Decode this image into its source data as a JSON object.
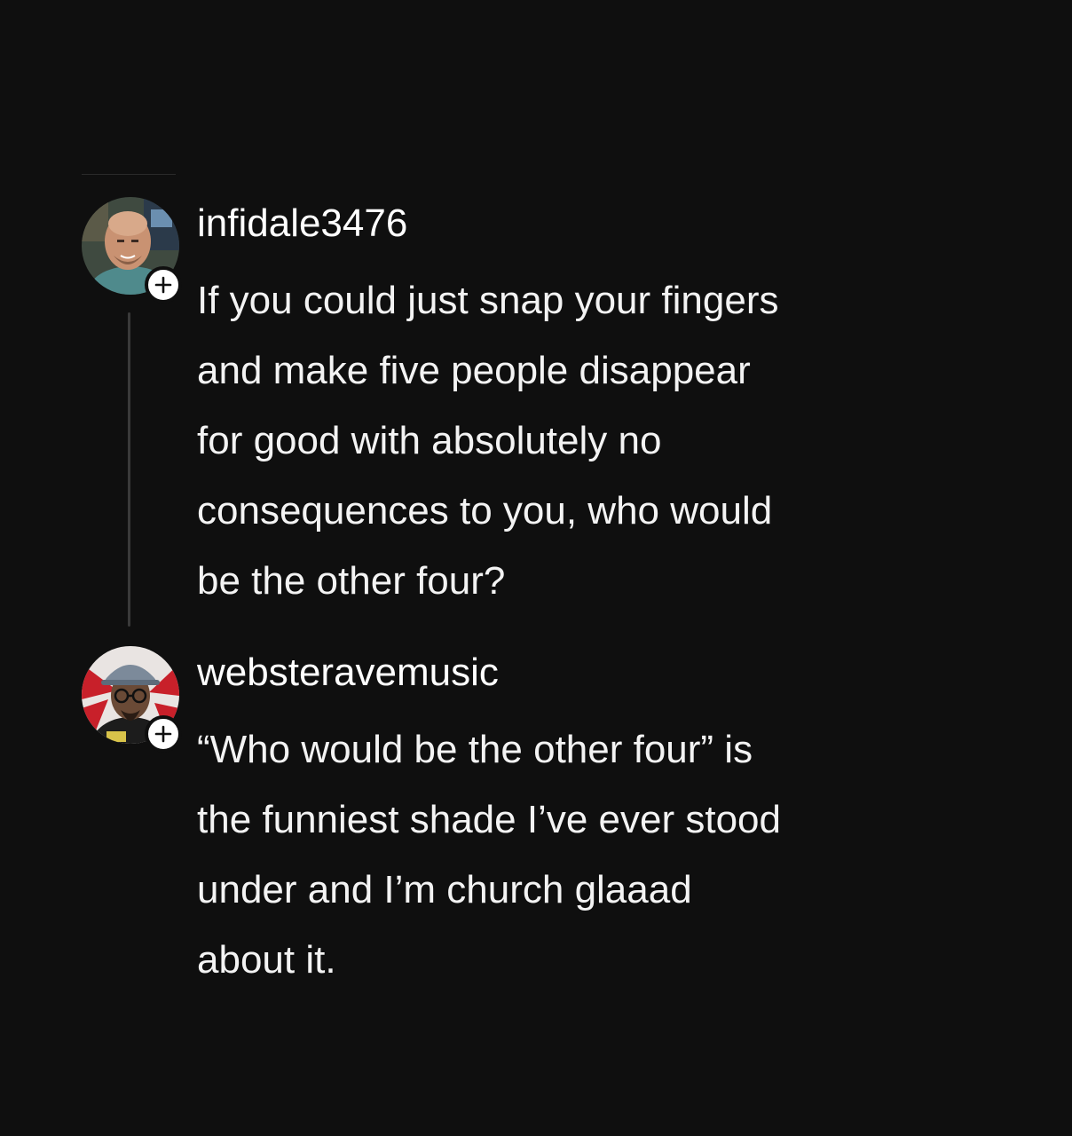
{
  "thread": {
    "posts": [
      {
        "username": "infidale3476",
        "avatar_icon": "user-avatar-photo",
        "follow_icon": "plus-icon",
        "lines": [
          "If you could just snap your fingers",
          "and make five people disappear",
          "for good with absolutely no",
          "consequences to you, who would",
          "be the other four?"
        ]
      },
      {
        "username": "websteravemusic",
        "avatar_icon": "user-avatar-photo",
        "follow_icon": "plus-icon",
        "lines": [
          "“Who would be the other four” is",
          "the funniest shade I’ve ever stood",
          "under and I’m church glaaad",
          "about it."
        ]
      }
    ]
  },
  "colors": {
    "background": "#0f0f0f",
    "text": "#f3f3f3",
    "thread_line": "#3a3a3a",
    "badge": "#ffffff"
  }
}
